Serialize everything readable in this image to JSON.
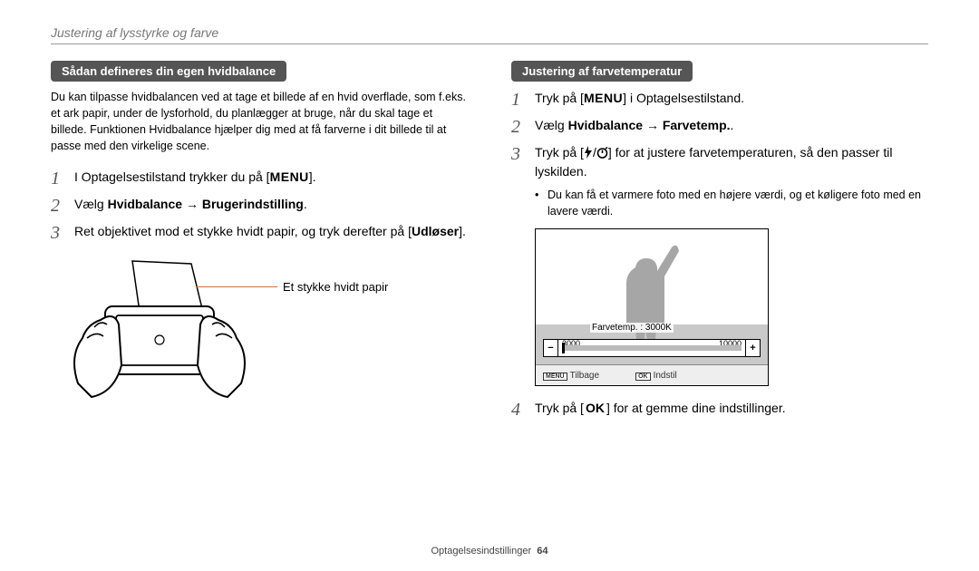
{
  "header": "Justering af lysstyrke og farve",
  "left": {
    "heading": "Sådan defineres din egen hvidbalance",
    "intro": "Du kan tilpasse hvidbalancen ved at tage et billede af en hvid overflade, som f.eks. et ark papir, under de lysforhold, du planlægger at bruge, når du skal tage et billede. Funktionen Hvidbalance hjælper dig med at få farverne i dit billede til at passe med den virkelige scene.",
    "steps": {
      "s1_pre": "I Optagelsestilstand trykker du på [",
      "s1_btn": "MENU",
      "s1_post": "].",
      "s2_pre": "Vælg ",
      "s2_bold": "Hvidbalance → Brugerindstilling",
      "s2_post": ".",
      "s3_pre": "Ret objektivet mod et stykke hvidt papir, og tryk derefter på [",
      "s3_bold": "Udløser",
      "s3_post": "]."
    },
    "callout": "Et stykke hvidt papir"
  },
  "right": {
    "heading": "Justering af farvetemperatur",
    "steps": {
      "s1_pre": "Tryk på [",
      "s1_btn": "MENU",
      "s1_post": "] i Optagelsestilstand.",
      "s2_pre": "Vælg ",
      "s2_bold": "Hvidbalance → Farvetemp.",
      "s2_post": ".",
      "s3_pre": "Tryk på [",
      "s3_icons_sep": "/",
      "s3_post": "] for at justere farvetemperaturen, så den passer til lyskilden.",
      "s3_bullet": "Du kan få et varmere foto med en højere værdi, og et køligere foto med en lavere værdi.",
      "s4_pre": "Tryk på [",
      "s4_btn": "OK",
      "s4_post": "] for at gemme dine indstillinger."
    },
    "screen": {
      "label": "Farvetemp. : 3000K",
      "min": "3000",
      "max": "10000",
      "minus": "−",
      "plus": "+",
      "back_tag": "MENU",
      "back_text": "Tilbage",
      "set_tag": "OK",
      "set_text": "Indstil"
    }
  },
  "footer": {
    "section": "Optagelsesindstillinger",
    "page": "64"
  }
}
